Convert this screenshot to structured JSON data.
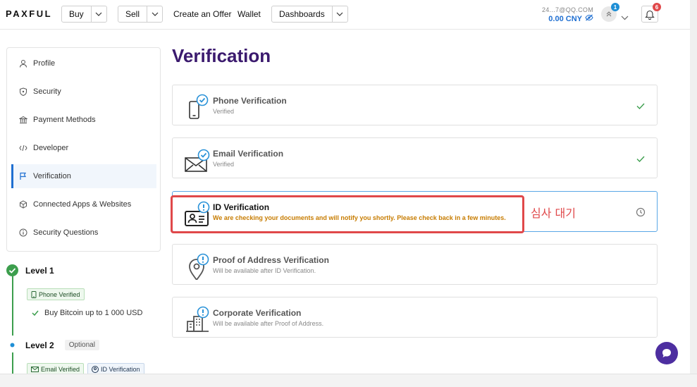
{
  "header": {
    "logo": "PAXFUL",
    "buy_label": "Buy",
    "sell_label": "Sell",
    "create_offer_label": "Create an Offer",
    "wallet_label": "Wallet",
    "dashboards_label": "Dashboards",
    "account_email": "24...7@QQ.COM",
    "balance": "0.00 CNY",
    "messages_badge": "1",
    "notifications_badge": "6"
  },
  "sidebar": {
    "items": [
      {
        "label": "Profile",
        "icon": "user-icon"
      },
      {
        "label": "Security",
        "icon": "shield-icon"
      },
      {
        "label": "Payment Methods",
        "icon": "bank-icon"
      },
      {
        "label": "Developer",
        "icon": "code-icon"
      },
      {
        "label": "Verification",
        "icon": "flag-icon"
      },
      {
        "label": "Connected Apps & Websites",
        "icon": "cube-icon"
      },
      {
        "label": "Security Questions",
        "icon": "info-icon"
      }
    ],
    "active_index": 4
  },
  "levels": {
    "level1": {
      "label": "Level 1",
      "chip": "Phone Verified",
      "perk": "Buy Bitcoin up to 1 000 USD"
    },
    "level2": {
      "label": "Level 2",
      "tag": "Optional",
      "chips": [
        "Email Verified",
        "ID Verification"
      ]
    }
  },
  "main": {
    "title": "Verification",
    "cards": [
      {
        "title": "Phone Verification",
        "subtitle": "Verified",
        "status": "check"
      },
      {
        "title": "Email Verification",
        "subtitle": "Verified",
        "status": "check"
      },
      {
        "title": "ID Verification",
        "subtitle": "We are checking your documents and will notify you shortly. Please check back in a few minutes.",
        "status": "pending"
      },
      {
        "title": "Proof of Address Verification",
        "subtitle": "Will be available after ID Verification.",
        "status": "none"
      },
      {
        "title": "Corporate Verification",
        "subtitle": "Will be available after Proof of Address.",
        "status": "none"
      }
    ]
  },
  "annotation": {
    "text": "심사 대기"
  },
  "colors": {
    "brand_purple": "#3b1a6e",
    "accent_blue": "#1f6fd1",
    "success_green": "#3c9e4d",
    "warning_orange": "#c77c00",
    "annotation_red": "#e0484a"
  }
}
